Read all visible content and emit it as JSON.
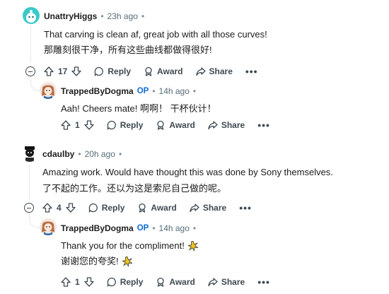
{
  "comments": [
    {
      "username": "UnattryHiggs",
      "time": "23h ago",
      "text_en": "That carving is clean af, great job with all those curves!",
      "text_zh": "那雕刻很干净，所有这些曲线都做得很好!",
      "votes": "17",
      "reply_label": "Reply",
      "award_label": "Award",
      "share_label": "Share",
      "more": "•••",
      "reply": {
        "username": "TrappedByDogma",
        "badge": "OP",
        "time": "14h ago",
        "text_en": "Aah! Cheers mate!  啊啊！  干杯伙计！",
        "votes": "1",
        "reply_label": "Reply",
        "award_label": "Award",
        "share_label": "Share",
        "more": "•••"
      }
    },
    {
      "username": "cdaulby",
      "time": "20h ago",
      "text_en": "Amazing work. Would have thought this was done by Sony themselves.",
      "text_zh": "了不起的工作。还以为这是索尼自己做的呢。",
      "votes": "4",
      "reply_label": "Reply",
      "award_label": "Award",
      "share_label": "Share",
      "more": "•••",
      "reply": {
        "username": "TrappedByDogma",
        "badge": "OP",
        "time": "14h ago",
        "text_en": "Thank you for the compliment!",
        "text_zh": "谢谢您的夸奖!",
        "votes": "1",
        "reply_label": "Reply",
        "award_label": "Award",
        "share_label": "Share",
        "more": "•••"
      }
    }
  ],
  "separator": "•",
  "colors": {
    "op": "#0a6bd6",
    "thread_line": "#e5e7e9",
    "text": "#1c1c1c",
    "meta": "#586d7a"
  }
}
